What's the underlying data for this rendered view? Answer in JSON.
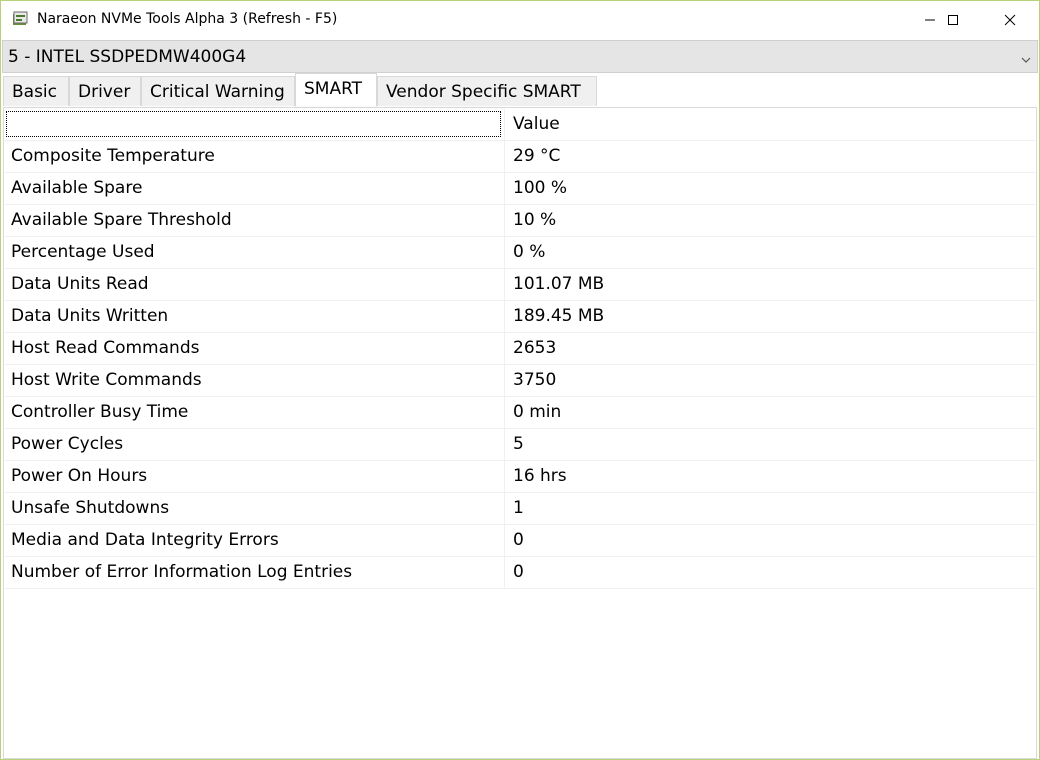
{
  "window": {
    "title": "Naraeon NVMe Tools Alpha 3 (Refresh - F5)",
    "accent_border": "#b9d27a"
  },
  "drive_select": {
    "selected": "5 - INTEL SSDPEDMW400G4"
  },
  "tabs": [
    {
      "label": "Basic",
      "active": false
    },
    {
      "label": "Driver",
      "active": false
    },
    {
      "label": "Critical Warning",
      "active": false
    },
    {
      "label": "SMART",
      "active": true
    },
    {
      "label": "Vendor Specific SMART",
      "active": false
    }
  ],
  "table": {
    "header": {
      "name": "",
      "value": "Value"
    },
    "rows": [
      {
        "name": "Composite Temperature",
        "value": "29 °C"
      },
      {
        "name": "Available Spare",
        "value": "100 %"
      },
      {
        "name": "Available Spare Threshold",
        "value": "10 %"
      },
      {
        "name": "Percentage Used",
        "value": "0 %"
      },
      {
        "name": "Data Units Read",
        "value": "101.07 MB"
      },
      {
        "name": "Data Units Written",
        "value": "189.45 MB"
      },
      {
        "name": "Host Read Commands",
        "value": "2653"
      },
      {
        "name": "Host Write Commands",
        "value": "3750"
      },
      {
        "name": "Controller Busy Time",
        "value": "0 min"
      },
      {
        "name": "Power Cycles",
        "value": "5"
      },
      {
        "name": "Power On Hours",
        "value": "16 hrs"
      },
      {
        "name": "Unsafe Shutdowns",
        "value": "1"
      },
      {
        "name": "Media and Data Integrity Errors",
        "value": "0"
      },
      {
        "name": "Number of Error Information Log Entries",
        "value": "0"
      }
    ]
  },
  "icons": {
    "app": "app-icon",
    "minimize": "minimize-icon",
    "maximize": "maximize-icon",
    "close": "close-icon",
    "dropdown": "chevron-down-icon"
  }
}
